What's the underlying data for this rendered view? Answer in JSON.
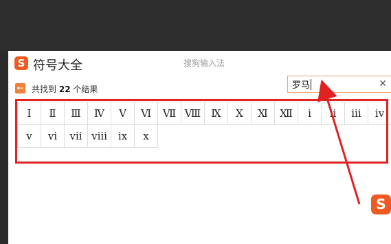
{
  "app": {
    "logo_glyph": "S",
    "title": "符号大全",
    "window_title": "搜狗输入法"
  },
  "results": {
    "back_glyph": "←",
    "prefix": "共找到",
    "count": "22",
    "suffix": "个结果"
  },
  "search": {
    "value": "罗马",
    "clear_glyph": "✕"
  },
  "symbols": [
    "Ⅰ",
    "Ⅱ",
    "Ⅲ",
    "Ⅳ",
    "Ⅴ",
    "Ⅵ",
    "Ⅶ",
    "Ⅷ",
    "Ⅸ",
    "Ⅹ",
    "Ⅺ",
    "Ⅻ",
    "ⅰ",
    "ⅱ",
    "ⅲ",
    "ⅳ",
    "ⅴ",
    "ⅵ",
    "ⅶ",
    "ⅷ",
    "ⅸ",
    "ⅹ"
  ],
  "float_logo_glyph": "S",
  "colors": {
    "brand_orange": "#f05a22",
    "annotation_red": "#e02222"
  }
}
